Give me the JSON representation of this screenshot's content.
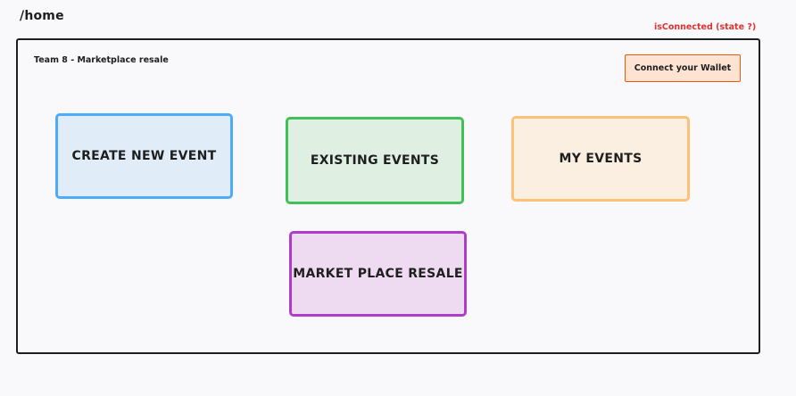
{
  "page": {
    "route": "/home",
    "state_note": "isConnected (state ?)"
  },
  "header": {
    "title": "Team 8 - Marketplace resale",
    "wallet_button_label": "Connect your Wallet"
  },
  "cards": {
    "create_event": "CREATE NEW EVENT",
    "existing_events": "EXISTING EVENTS",
    "my_events": "MY EVENTS",
    "market_place_resale": "MARKET PLACE RESALE"
  },
  "colors": {
    "annotation": "#e03131",
    "wallet_border": "#e8590c",
    "wallet_fill": "#ffe3d2",
    "create_border": "#4dabf7",
    "create_fill": "#e0edf9",
    "existing_border": "#40c057",
    "existing_fill": "#dff0e3",
    "my_border": "#ffc078",
    "my_fill": "#fbefe2",
    "resale_border": "#ae3ec9",
    "resale_fill": "#efdbf1"
  }
}
